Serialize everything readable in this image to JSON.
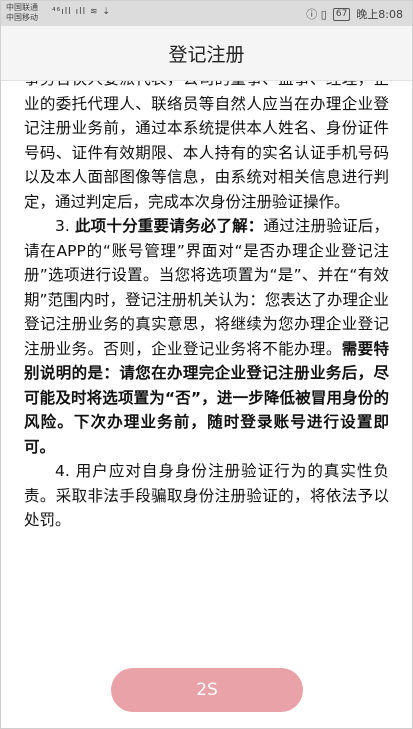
{
  "status_bar": {
    "carrier_1": "中国联通",
    "carrier_2": "中国移动",
    "signal_icons": "⁴⁶ıll ıll ≋ ⇣",
    "right_icons": "ⓘ ▯",
    "battery": "67",
    "time": "晚上8:08"
  },
  "header": {
    "title": "登记注册"
  },
  "body": {
    "p1": "事务合伙人委派代表，公司的董事、监事、经理，企业的委托代理人、联络员等自然人应当在办理企业登记注册业务前，通过本系统提供本人姓名、身份证件号码、证件有效期限、本人持有的实名认证手机号码以及本人面部图像等信息，由系统对相关信息进行判定，通过判定后，完成本次身份注册验证操作。",
    "p2_lead": "3. ",
    "p2_bold": "此项十分重要请务必了解：",
    "p2_text": "通过注册验证后，请在APP的“账号管理”界面对“是否办理企业登记注册”选项进行设置。当您将选项置为“是”、并在“有效期”范围内时，登记注册机关认为：您表达了办理企业登记注册业务的真实意思，将继续为您办理企业登记注册业务。否则，企业登记业务将不能办理。",
    "p2_bold2": "需要特别说明的是：请您在办理完企业登记注册业务后，尽可能及时将选项置为“否”，进一步降低被冒用身份的风险。下次办理业务前，随时登录账号进行设置即可。",
    "p3": "4. 用户应对自身身份注册验证行为的真实性负责。采取非法手段骗取身份注册验证的，将依法予以处罚。"
  },
  "footer": {
    "button_label": "2S",
    "button_color": "#e9a3a8"
  }
}
